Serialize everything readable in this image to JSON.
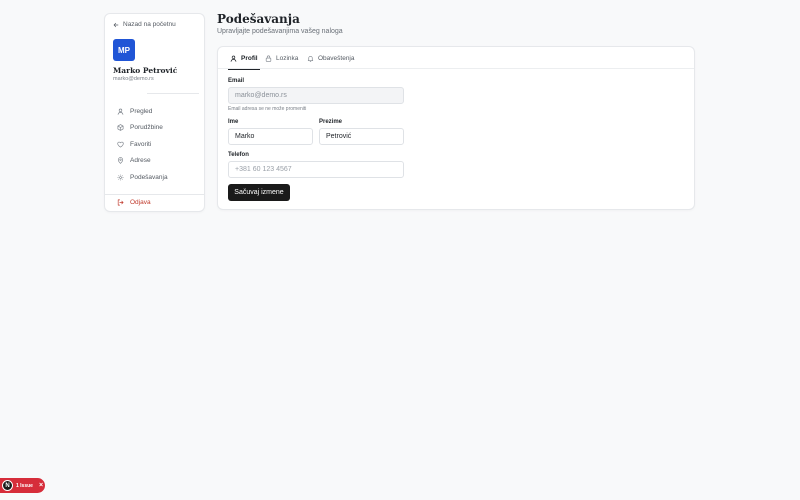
{
  "sidebar": {
    "back_label": "Nazad na početnu",
    "avatar_initials": "MP",
    "user_name": "Marko Petrović",
    "user_email": "marko@demo.rs",
    "items": [
      {
        "label": "Pregled",
        "icon": "user-icon"
      },
      {
        "label": "Porudžbine",
        "icon": "package-icon"
      },
      {
        "label": "Favoriti",
        "icon": "heart-icon"
      },
      {
        "label": "Adrese",
        "icon": "map-pin-icon"
      },
      {
        "label": "Podešavanja",
        "icon": "gear-icon"
      }
    ],
    "logout_label": "Odjava"
  },
  "header": {
    "title": "Podešavanja",
    "subtitle": "Upravljajte podešavanjima vašeg naloga"
  },
  "tabs": [
    {
      "label": "Profil",
      "active": true
    },
    {
      "label": "Lozinka",
      "active": false
    },
    {
      "label": "Obaveštenja",
      "active": false
    }
  ],
  "form": {
    "email_label": "Email",
    "email_value": "marko@demo.rs",
    "email_hint": "Email adresa se ne može promeniti",
    "first_name_label": "Ime",
    "first_name_value": "Marko",
    "last_name_label": "Prezime",
    "last_name_value": "Petrović",
    "phone_label": "Telefon",
    "phone_placeholder": "+381 60 123 4567",
    "save_label": "Sačuvaj izmene"
  },
  "issue_badge": {
    "logo": "N",
    "label": "1 Issue"
  },
  "colors": {
    "accent": "#2055d6",
    "danger": "#c0392b",
    "primary_button": "#1a1a1a"
  }
}
